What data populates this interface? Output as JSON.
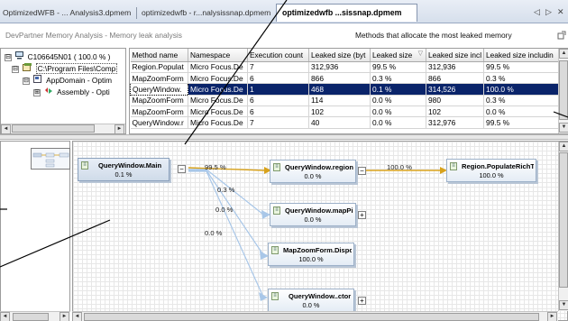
{
  "tabs": [
    {
      "label": "OptimizedWFB - ... Analysis3.dpmem"
    },
    {
      "label": "optimizedwfb - r...nalysissnap.dpmem"
    },
    {
      "label": "optimizedwfb ...sissnap.dpmem"
    }
  ],
  "tab_nav": {
    "prev": "◁",
    "next": "▷",
    "close": "✕"
  },
  "header": {
    "left_title": "DevPartner Memory Analysis - Memory leak analysis",
    "right_title": "Methods that allocate the most leaked memory",
    "options_icon": "options-icon"
  },
  "tree": {
    "items": [
      {
        "label": "C106645N01 ( 100.0 % )",
        "expander": "⊟",
        "icon": "computer-icon"
      },
      {
        "label": "C:\\Program Files\\Comp",
        "expander": "⊟",
        "icon": "process-icon"
      },
      {
        "label": "AppDomain - Optim",
        "expander": "⊟",
        "icon": "appdomain-icon"
      },
      {
        "label": "Assembly - Opti",
        "expander": "⊞",
        "icon": "assembly-icon"
      }
    ]
  },
  "grid": {
    "columns": [
      "Method name",
      "Namespace",
      "Execution count",
      "Leaked size (byt",
      "Leaked size",
      "Leaked size incl",
      "Leaked size includin"
    ],
    "sort_indicator": "▽",
    "rows": [
      [
        "Region.Populat",
        "Micro Focus.De",
        "7",
        "312,936",
        "99.5 %",
        "312,936",
        "99.5 %"
      ],
      [
        "MapZoomForm",
        "Micro Focus.De",
        "6",
        "866",
        "0.3 %",
        "866",
        "0.3 %"
      ],
      [
        "QueryWindow.",
        "Micro Focus.De",
        "1",
        "468",
        "0.1 %",
        "314,526",
        "100.0 %"
      ],
      [
        "MapZoomForm",
        "Micro Focus.De",
        "6",
        "114",
        "0.0 %",
        "980",
        "0.3 %"
      ],
      [
        "MapZoomForm",
        "Micro Focus.De",
        "6",
        "102",
        "0.0 %",
        "102",
        "0.0 %"
      ],
      [
        "QueryWindow.r",
        "Micro Focus.De",
        "7",
        "40",
        "0.0 %",
        "312,976",
        "99.5 %"
      ]
    ],
    "selected_row": 2
  },
  "graph": {
    "nodes": [
      {
        "name": "QueryWindow.Main",
        "pct": "0.1 %"
      },
      {
        "name": "QueryWindow.regionL...",
        "pct": "0.0 %"
      },
      {
        "name": "Region.PopulateRichT...",
        "pct": "100.0 %"
      },
      {
        "name": "QueryWindow.mapPic...",
        "pct": "0.0 %"
      },
      {
        "name": "MapZoomForm.Dispose",
        "pct": "100.0 %"
      },
      {
        "name": "QueryWindow..ctor",
        "pct": "0.0 %"
      }
    ],
    "edges": [
      {
        "label": "99.5 %"
      },
      {
        "label": "100.0 %"
      },
      {
        "label": "0.3 %"
      },
      {
        "label": "0.0 %"
      },
      {
        "label": "0.0 %"
      }
    ],
    "highlight_color": "#d8a21c",
    "edge_color": "#a9c7e8"
  },
  "scroll_arrows": {
    "up": "▲",
    "down": "▼",
    "left": "◄",
    "right": "►"
  }
}
